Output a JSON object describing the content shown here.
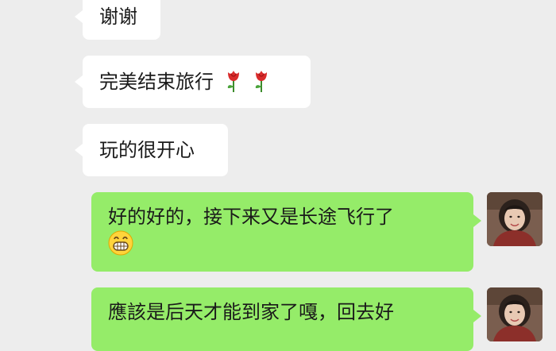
{
  "messages": [
    {
      "side": "left",
      "text": "谢谢"
    },
    {
      "side": "left",
      "text": "完美结束旅行",
      "emoji": [
        "rose-emoji",
        "rose-emoji"
      ]
    },
    {
      "side": "left",
      "text": "玩的很开心"
    },
    {
      "side": "right",
      "text": "好的好的，接下来又是长途飞行了",
      "emoji": [
        "grinning-face-emoji"
      ]
    },
    {
      "side": "right",
      "text": "應該是后天才能到家了嘎，回去好"
    }
  ],
  "colors": {
    "background": "#ededed",
    "incoming_bubble": "#ffffff",
    "outgoing_bubble": "#95ec69",
    "text": "#1a1a1a"
  }
}
